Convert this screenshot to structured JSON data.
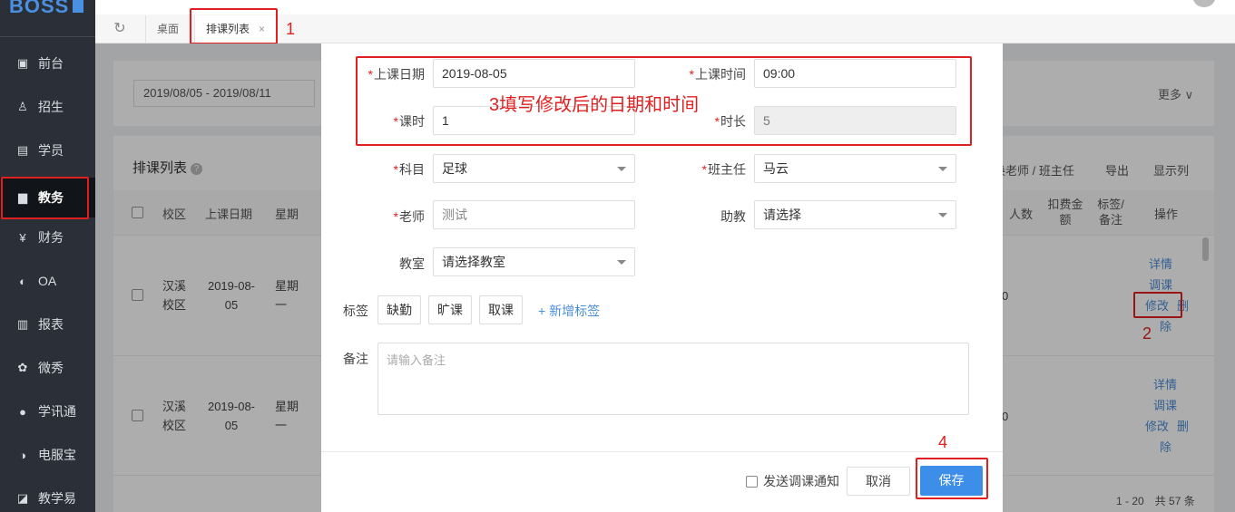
{
  "app": {
    "logo": "BOSS"
  },
  "sidebar": {
    "items": [
      {
        "label": "前台",
        "icon": "calendar-icon"
      },
      {
        "label": "招生",
        "icon": "user-add-icon"
      },
      {
        "label": "学员",
        "icon": "id-card-icon"
      },
      {
        "label": "教务",
        "icon": "book-icon",
        "active": true
      },
      {
        "label": "财务",
        "icon": "yen-icon"
      },
      {
        "label": "OA",
        "icon": "chat-icon"
      },
      {
        "label": "报表",
        "icon": "bar-chart-icon"
      },
      {
        "label": "微秀",
        "icon": "show-icon"
      },
      {
        "label": "学讯通",
        "icon": "location-icon"
      },
      {
        "label": "电服宝",
        "icon": "service-icon"
      },
      {
        "label": "教学易",
        "icon": "teach-icon"
      }
    ]
  },
  "tabs": [
    {
      "label": "桌面"
    },
    {
      "label": "排课列表",
      "close": "×",
      "active": true
    }
  ],
  "annotations": {
    "a1": "1",
    "a2": "2",
    "a3": "3填写修改后的日期和时间",
    "a4": "4"
  },
  "filter": {
    "date_range": "2019/08/05 - 2019/08/11",
    "more": "更多 ∨"
  },
  "list": {
    "title": "排课列表",
    "help": "?",
    "actions": [
      "换老师 / 班主任",
      "导出",
      "显示列"
    ],
    "headers": [
      "校区",
      "上课日期",
      "星期",
      "人数",
      "扣费金额",
      "标签/备注",
      "操作"
    ],
    "rows": [
      {
        "campus": "汉溪校区",
        "date": "2019-08-05",
        "weekday": "星期一",
        "count": "0",
        "ops": [
          "详情",
          "调课",
          "修改",
          "删除"
        ]
      },
      {
        "campus": "汉溪校区",
        "date": "2019-08-05",
        "weekday": "星期一",
        "count": "0",
        "ops": [
          "详情",
          "调课",
          "修改",
          "删除"
        ]
      }
    ],
    "pager": "1 - 20　共 57 条"
  },
  "form": {
    "date_label": "上课日期",
    "date_value": "2019-08-05",
    "time_label": "上课时间",
    "time_value": "09:00",
    "lessons_label": "课时",
    "lessons_value": "1",
    "duration_label": "时长",
    "duration_value": "5",
    "subject_label": "科目",
    "subject_value": "足球",
    "headteacher_label": "班主任",
    "headteacher_value": "马云",
    "teacher_label": "老师",
    "teacher_placeholder": "测试",
    "assistant_label": "助教",
    "assistant_value": "请选择",
    "room_label": "教室",
    "room_value": "请选择教室",
    "tags_label": "标签",
    "tags": [
      "缺勤",
      "旷课",
      "取课"
    ],
    "add_tag": "+ 新增标签",
    "note_label": "备注",
    "note_placeholder": "请输入备注",
    "required_mark": "*"
  },
  "footer": {
    "notify": "发送调课通知",
    "cancel": "取消",
    "save": "保存"
  }
}
